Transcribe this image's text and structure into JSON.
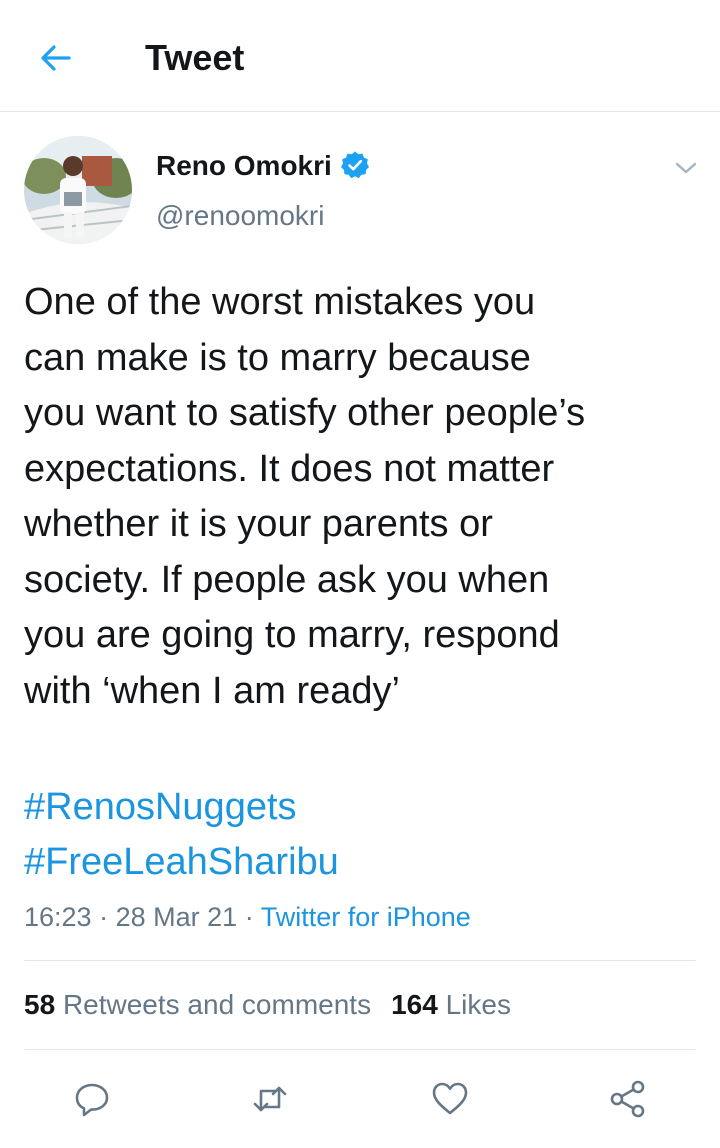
{
  "header": {
    "title": "Tweet",
    "back_icon": "arrow-left-icon",
    "accent": "#1da1f2"
  },
  "author": {
    "name": "Reno Omokri",
    "handle": "@renoomokri",
    "verified": true,
    "verified_icon": "verified-badge-icon"
  },
  "tweet": {
    "text": "One of the worst mistakes you\ncan make is to marry because\nyou want to satisfy other people’s\nexpectations. It does not matter\nwhether it is your parents or\nsociety. If people ask you when\nyou are going to marry, respond\nwith ‘when I am ready’",
    "hashtags": [
      "#RenosNuggets",
      "#FreeLeahSharibu"
    ],
    "time": "16:23",
    "date": "28 Mar 21",
    "source": "Twitter for iPhone",
    "separator": "·"
  },
  "stats": {
    "retweets_count": "58",
    "retweets_label": "Retweets and comments",
    "likes_count": "164",
    "likes_label": "Likes"
  },
  "actions": [
    "reply-icon",
    "retweet-icon",
    "like-icon",
    "share-icon"
  ],
  "colors": {
    "link": "#1b95e0",
    "secondary": "#657786",
    "text": "#14171a",
    "divider": "#e1e8ed"
  }
}
